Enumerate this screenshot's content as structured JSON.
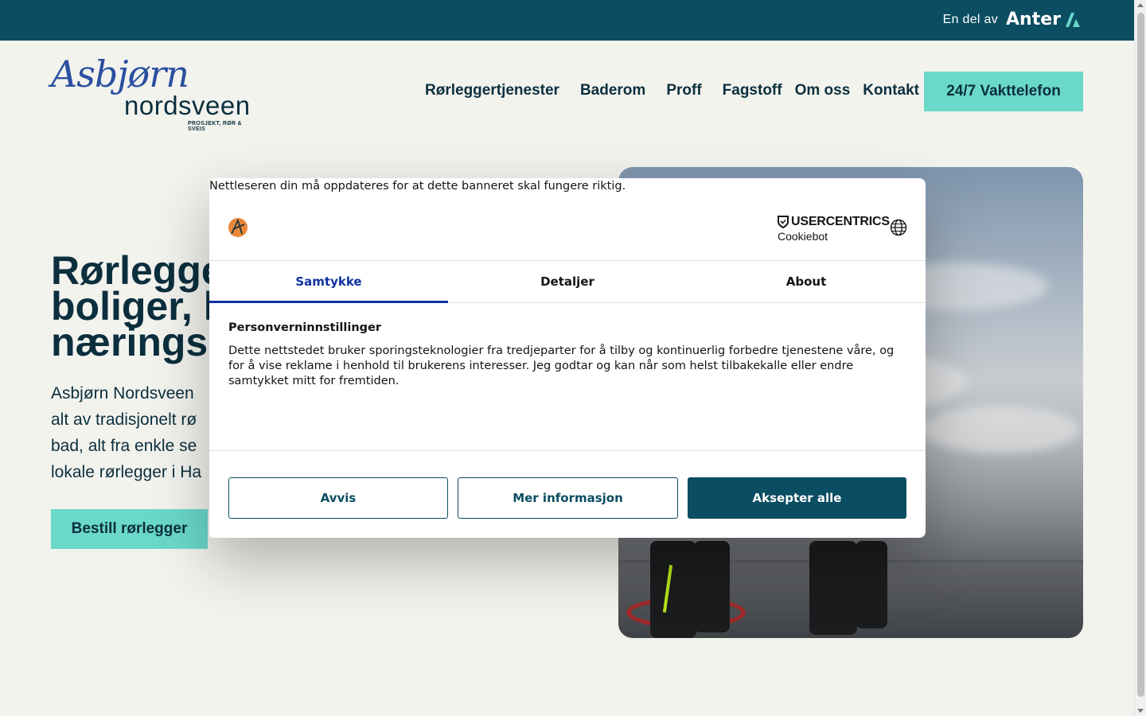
{
  "topbar": {
    "part_of_label": "En del av",
    "partner_name": "Anter"
  },
  "logo": {
    "script": "Asbjørn",
    "word": "nordsveen",
    "tagline": "PROSJEKT, RØR & SVEIS"
  },
  "nav": {
    "items": [
      {
        "label": "Rørleggertjenester"
      },
      {
        "label": "Baderom"
      },
      {
        "label": "Proff"
      },
      {
        "label": "Fagstoff"
      },
      {
        "label": "Om oss"
      },
      {
        "label": "Kontakt"
      }
    ],
    "cta": "24/7 Vakttelefon"
  },
  "hero": {
    "title_lines": [
      "Rørlegge",
      "boliger, h",
      "næringsb"
    ],
    "text_lines": [
      "Asbjørn Nordsveen",
      "alt av tradisjonelt rø",
      "bad, alt fra enkle se",
      "lokale rørlegger i Ha"
    ],
    "button": "Bestill rørlegger"
  },
  "cookie_dialog": {
    "warning": "Nettleseren din må oppdateres for at dette banneret skal fungere riktig.",
    "provider_name": "USERCENTRICS",
    "provider_product": "Cookiebot",
    "tabs": [
      {
        "label": "Samtykke",
        "active": true
      },
      {
        "label": "Detaljer",
        "active": false
      },
      {
        "label": "About",
        "active": false
      }
    ],
    "heading": "Personverninnstillinger",
    "body": "Dette nettstedet bruker sporingsteknologier fra tredjeparter for å tilby og kontinuerlig forbedre tjenestene våre, og for å vise reklame i henhold til brukerens interesser. Jeg godtar og kan når som helst tilbakekalle eller endre samtykket mitt for fremtiden.",
    "buttons": {
      "reject": "Avvis",
      "more_info": "Mer informasjon",
      "accept_all": "Aksepter alle"
    }
  },
  "colors": {
    "brand_dark": "#0b4d61",
    "accent": "#6ad9c9",
    "page_bg": "#f3f3ee",
    "text_dark": "#0c2f3e",
    "tab_active": "#1032a0"
  }
}
